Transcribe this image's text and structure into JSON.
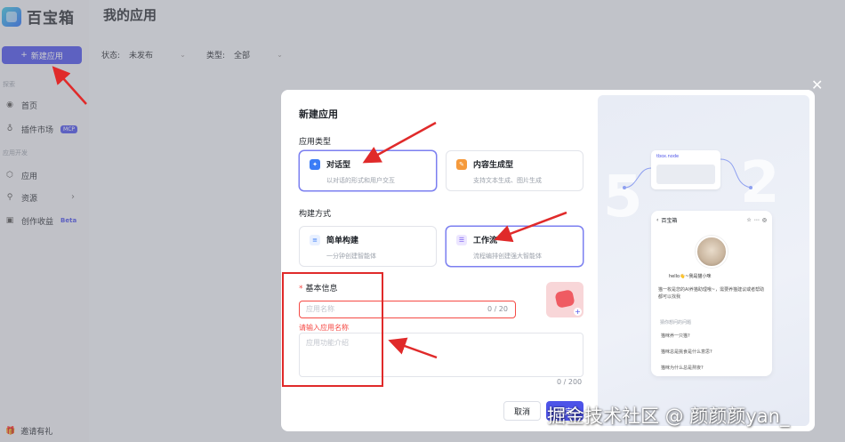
{
  "app": {
    "name": "百宝箱",
    "page_title": "我的应用"
  },
  "sidebar": {
    "new_app_label": "新建应用",
    "section_explore": "探索",
    "section_dev": "应用开发",
    "items": [
      {
        "label": "首页"
      },
      {
        "label": "插件市场",
        "badge": "MCP"
      },
      {
        "label": "应用"
      },
      {
        "label": "资源"
      },
      {
        "label": "创作收益",
        "badge": "Beta"
      }
    ],
    "invite": "邀请有礼"
  },
  "filters": {
    "status_label": "状态:",
    "status_value": "未发布",
    "type_label": "类型:",
    "type_value": "全部"
  },
  "modal": {
    "title": "新建应用",
    "app_type_label": "应用类型",
    "app_types": [
      {
        "title": "对话型",
        "desc": "以对话的形式和用户交互",
        "selected": true
      },
      {
        "title": "内容生成型",
        "desc": "支持文本生成、图片生成",
        "selected": false
      }
    ],
    "build_label": "构建方式",
    "build_methods": [
      {
        "title": "简单构建",
        "desc": "一分钟创建智能体",
        "selected": false
      },
      {
        "title": "工作流",
        "desc": "流程编排创建强大智能体",
        "selected": true
      }
    ],
    "basic_info_label": "基本信息",
    "name_placeholder": "应用名称",
    "name_count": "0 / 20",
    "name_error": "请输入应用名称",
    "desc_placeholder": "应用功能介绍",
    "desc_count": "0 / 200",
    "cancel_label": "取消",
    "confirm_label": "确定"
  },
  "preview": {
    "node_title": "tbox.node",
    "phone_title": "百宝箱",
    "greeting": "hello👋~我是猫小咪",
    "message": "猫一枚是您的AI养猫助理哦~，需要养猫建议或者帮助都可以找我",
    "suggest_label": "猜你想问的问题",
    "suggestions": [
      "猫咪养一只猫?",
      "猫咪总是挑食是什么意思?",
      "猫咪为什么总是熬夜?"
    ]
  },
  "watermark": "掘金技术社区 @ 颜颜颜yan_",
  "colors": {
    "accent": "#4d53e8",
    "error": "#f54a45",
    "annotation": "#e02a2a"
  }
}
